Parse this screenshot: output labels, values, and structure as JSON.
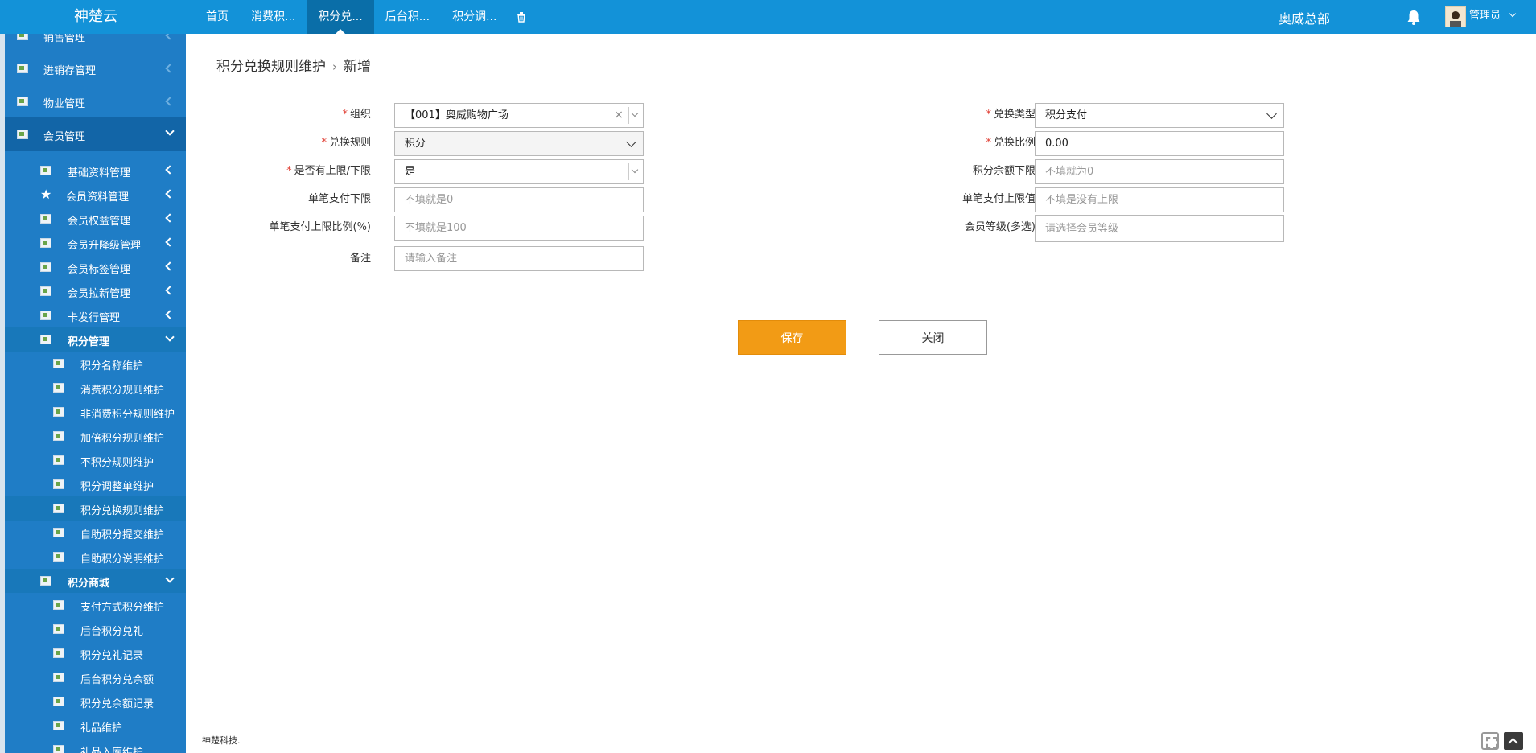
{
  "app": {
    "brand": "神楚云",
    "org": "奥威总部",
    "user": "管理员"
  },
  "nav": {
    "tabs": [
      {
        "label": "首页"
      },
      {
        "label": "消费积..."
      },
      {
        "label": "积分兑..."
      },
      {
        "label": "后台积..."
      },
      {
        "label": "积分调..."
      }
    ],
    "active_tab": "积分兑..."
  },
  "sidebar": {
    "items": [
      {
        "label": "销售管理"
      },
      {
        "label": "进销存管理"
      },
      {
        "label": "物业管理"
      },
      {
        "label": "会员管理"
      },
      {
        "label": "基础资料管理"
      },
      {
        "label": "会员资料管理"
      },
      {
        "label": "会员权益管理"
      },
      {
        "label": "会员升降级管理"
      },
      {
        "label": "会员标签管理"
      },
      {
        "label": "会员拉新管理"
      },
      {
        "label": "卡发行管理"
      },
      {
        "label": "积分管理"
      },
      {
        "label": "积分名称维护"
      },
      {
        "label": "消费积分规则维护"
      },
      {
        "label": "非消费积分规则维护"
      },
      {
        "label": "加倍积分规则维护"
      },
      {
        "label": "不积分规则维护"
      },
      {
        "label": "积分调整单维护"
      },
      {
        "label": "积分兑换规则维护"
      },
      {
        "label": "自助积分提交维护"
      },
      {
        "label": "自助积分说明维护"
      },
      {
        "label": "积分商城"
      },
      {
        "label": "支付方式积分维护"
      },
      {
        "label": "后台积分兑礼"
      },
      {
        "label": "积分兑礼记录"
      },
      {
        "label": "后台积分兑余额"
      },
      {
        "label": "积分兑余额记录"
      },
      {
        "label": "礼品维护"
      },
      {
        "label": "礼品入库维护"
      }
    ]
  },
  "breadcrumb": {
    "parent": "积分兑换规则维护",
    "sep": "›",
    "current": "新增"
  },
  "form": {
    "org": {
      "label": "组织",
      "value": "【001】奥威购物广场"
    },
    "rule": {
      "label": "兑换规则",
      "value": "积分"
    },
    "has_limit": {
      "label": "是否有上限/下限",
      "value": "是"
    },
    "single_min": {
      "label": "单笔支付下限",
      "placeholder": "不填就是0"
    },
    "single_max_ratio": {
      "label": "单笔支付上限比例(%)",
      "placeholder": "不填就是100"
    },
    "remark": {
      "label": "备注",
      "placeholder": "请输入备注"
    },
    "exchange_type": {
      "label": "兑换类型",
      "value": "积分支付"
    },
    "exchange_ratio": {
      "label": "兑换比例",
      "value": "0.00"
    },
    "balance_min": {
      "label": "积分余额下限",
      "placeholder": "不填就为0"
    },
    "single_max": {
      "label": "单笔支付上限值",
      "placeholder": "不填是没有上限"
    },
    "member_level": {
      "label": "会员等级(多选)",
      "placeholder": "请选择会员等级"
    }
  },
  "buttons": {
    "save": "保存",
    "close": "关闭"
  },
  "footer": {
    "text": "神楚科技."
  },
  "colors": {
    "topbar": "#1392d8",
    "sidebar": "#1f7dc6",
    "save": "#f29b15",
    "required": "#e03c31"
  }
}
